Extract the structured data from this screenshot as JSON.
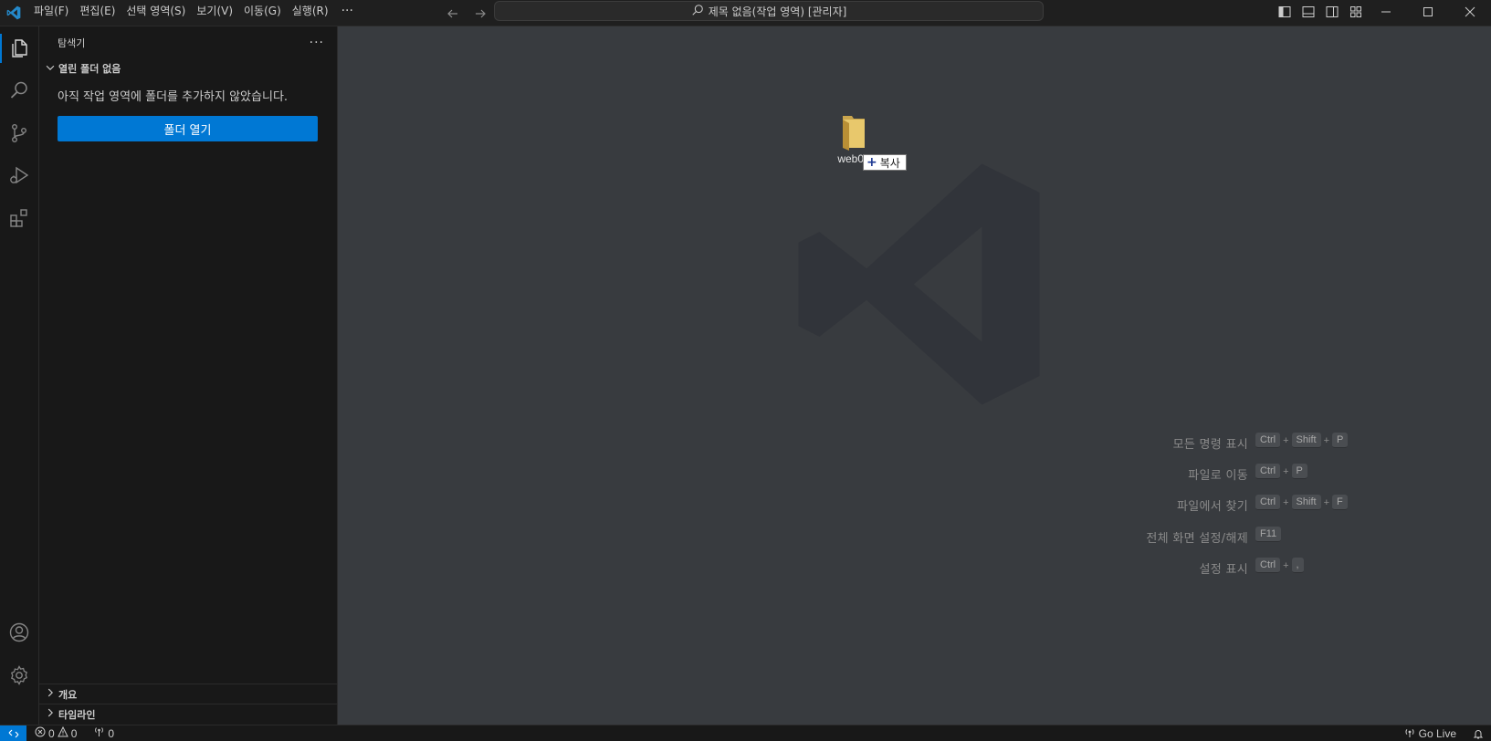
{
  "titlebar": {
    "menu": [
      "파일(F)",
      "편집(E)",
      "선택 영역(S)",
      "보기(V)",
      "이동(G)",
      "실행(R)"
    ],
    "more": "···",
    "command_center": "제목 없음(작업 영역) [관리자]"
  },
  "sidebar": {
    "title": "탐색기",
    "more": "···",
    "section_title": "열린 폴더 없음",
    "empty_message": "아직 작업 영역에 폴더를 추가하지 않았습니다.",
    "open_folder_label": "폴더 열기",
    "outline_label": "개요",
    "timeline_label": "타임라인"
  },
  "editor": {
    "drag_item": {
      "label": "web01",
      "tooltip": "복사"
    },
    "shortcuts": [
      {
        "label": "모든 명령 표시",
        "keys": [
          "Ctrl",
          "Shift",
          "P"
        ]
      },
      {
        "label": "파일로 이동",
        "keys": [
          "Ctrl",
          "P"
        ]
      },
      {
        "label": "파일에서 찾기",
        "keys": [
          "Ctrl",
          "Shift",
          "F"
        ]
      },
      {
        "label": "전체 화면 설정/해제",
        "keys": [
          "F11"
        ]
      },
      {
        "label": "설정 표시",
        "keys": [
          "Ctrl",
          ","
        ]
      }
    ]
  },
  "statusbar": {
    "errors": "0",
    "warnings": "0",
    "ports": "0",
    "golive": "Go Live"
  },
  "colors": {
    "accent": "#0078d4",
    "editor_bg": "#383b3f",
    "sidebar_bg": "#181818",
    "titlebar_bg": "#1f1f1f"
  }
}
